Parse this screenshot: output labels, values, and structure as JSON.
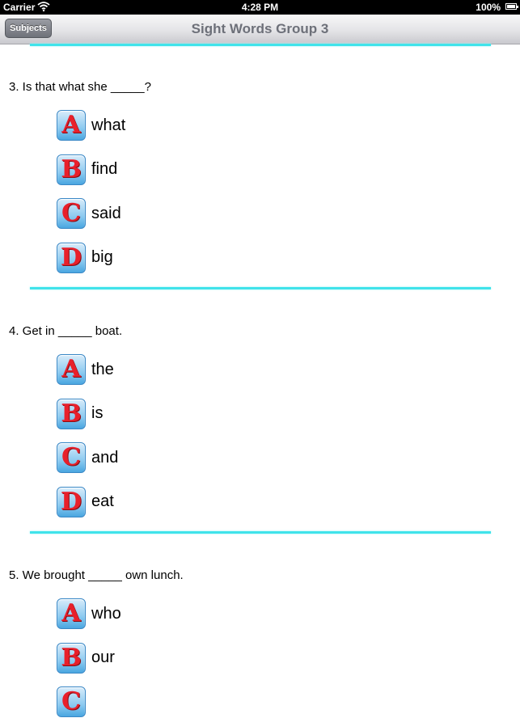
{
  "status_bar": {
    "carrier": "Carrier",
    "time": "4:28 PM",
    "battery": "100%"
  },
  "nav": {
    "back_label": "Subjects",
    "title": "Sight Words Group 3"
  },
  "colors": {
    "divider": "#40e3ea",
    "letter": "#e8202b",
    "letter_bg": "#8ccaf0"
  },
  "questions": [
    {
      "text": "3. Is that what she _____?",
      "answers": [
        {
          "letter": "A",
          "word": "what"
        },
        {
          "letter": "B",
          "word": "find"
        },
        {
          "letter": "C",
          "word": "said"
        },
        {
          "letter": "D",
          "word": "big"
        }
      ]
    },
    {
      "text": "4. Get in _____ boat.",
      "answers": [
        {
          "letter": "A",
          "word": "the"
        },
        {
          "letter": "B",
          "word": "is"
        },
        {
          "letter": "C",
          "word": "and"
        },
        {
          "letter": "D",
          "word": "eat"
        }
      ]
    },
    {
      "text": "5. We brought _____ own lunch.",
      "answers": [
        {
          "letter": "A",
          "word": "who"
        },
        {
          "letter": "B",
          "word": "our"
        },
        {
          "letter": "C",
          "word": ""
        }
      ]
    }
  ]
}
